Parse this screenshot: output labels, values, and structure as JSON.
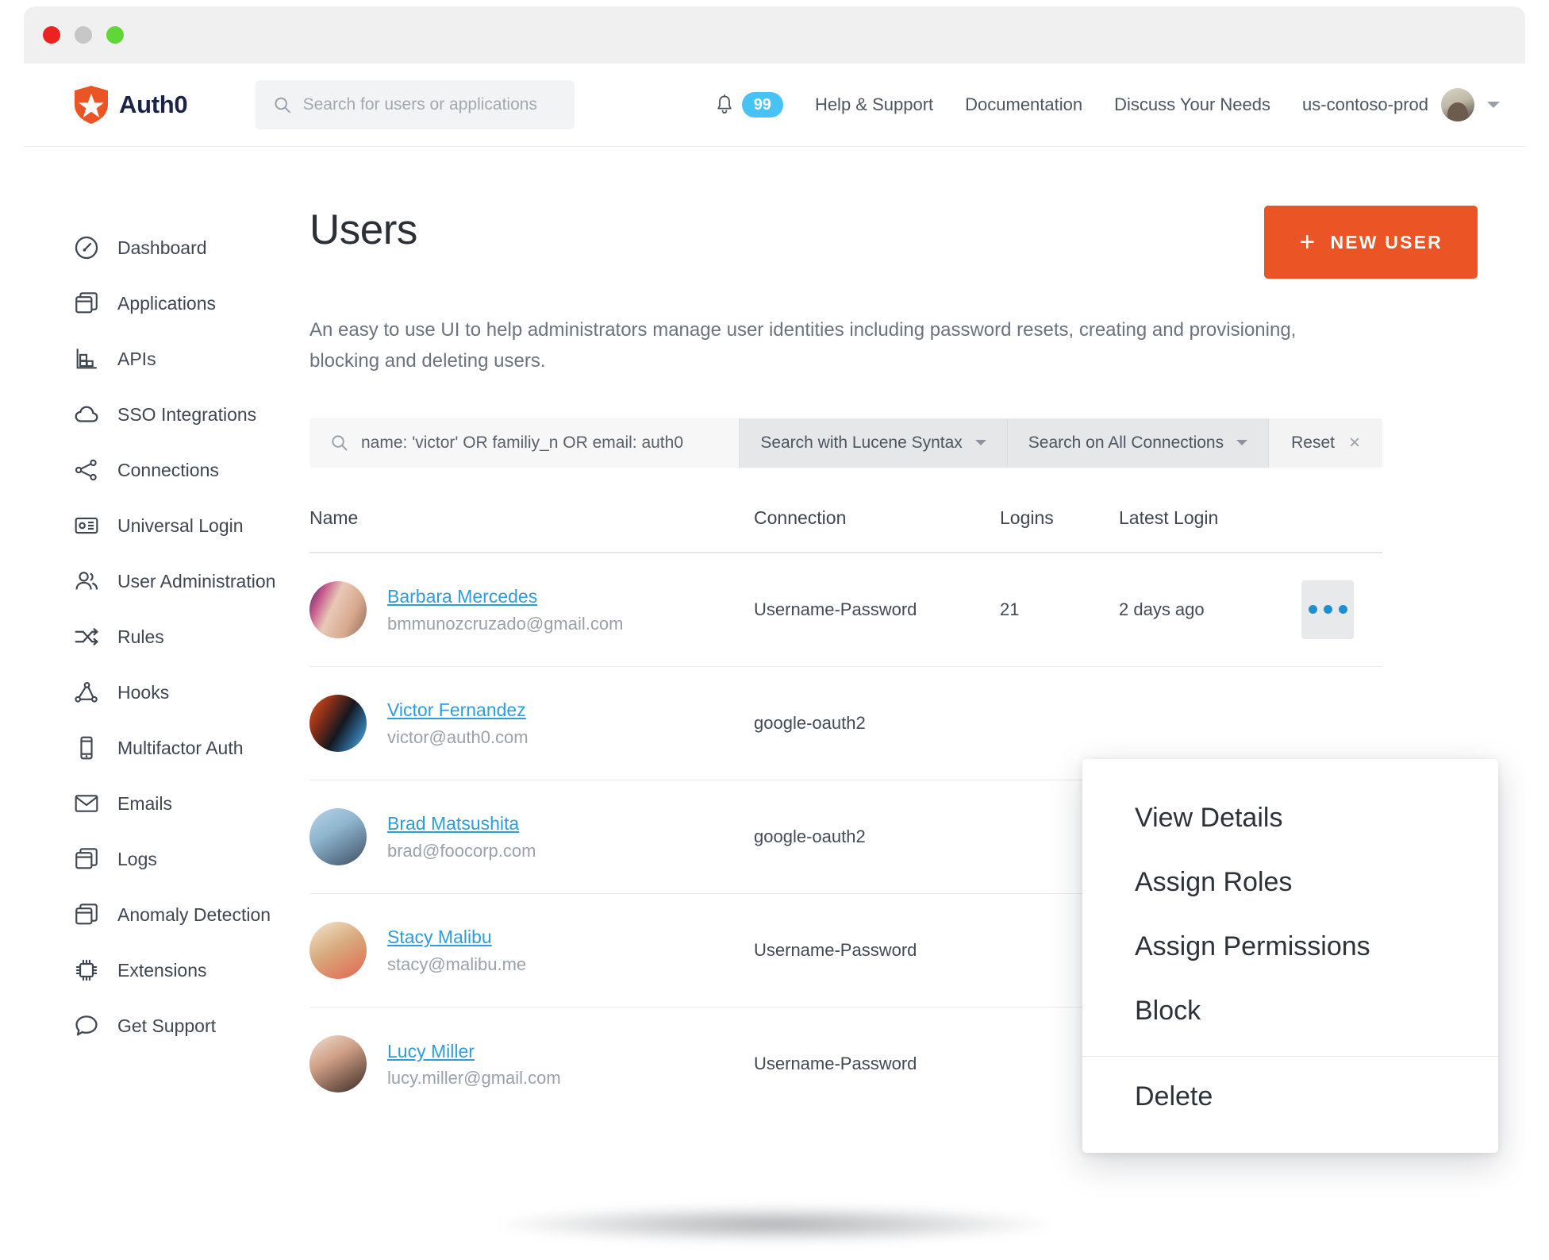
{
  "window_chrome": {
    "buttons": [
      "close",
      "minimize",
      "maximize"
    ]
  },
  "header": {
    "brand": "Auth0",
    "search_placeholder": "Search for users or applications",
    "search_value": "",
    "notifications_count": "99",
    "links": [
      {
        "label": "Help & Support"
      },
      {
        "label": "Documentation"
      },
      {
        "label": "Discuss Your Needs"
      }
    ],
    "tenant": "us-contoso-prod"
  },
  "sidebar": {
    "items": [
      {
        "label": "Dashboard",
        "icon": "gauge-icon"
      },
      {
        "label": "Applications",
        "icon": "windows-stack-icon"
      },
      {
        "label": "APIs",
        "icon": "bar-blocks-icon"
      },
      {
        "label": "SSO Integrations",
        "icon": "cloud-icon"
      },
      {
        "label": "Connections",
        "icon": "share-nodes-icon"
      },
      {
        "label": "Universal Login",
        "icon": "login-card-icon"
      },
      {
        "label": "User Administration",
        "icon": "users-icon"
      },
      {
        "label": "Rules",
        "icon": "arrows-shuffle-icon"
      },
      {
        "label": "Hooks",
        "icon": "hooks-graph-icon"
      },
      {
        "label": "Multifactor Auth",
        "icon": "mobile-device-icon"
      },
      {
        "label": "Emails",
        "icon": "envelope-icon"
      },
      {
        "label": "Logs",
        "icon": "windows-stack-icon"
      },
      {
        "label": "Anomaly Detection",
        "icon": "windows-stack-icon"
      },
      {
        "label": "Extensions",
        "icon": "chip-icon"
      },
      {
        "label": "Get Support",
        "icon": "speech-bubble-icon"
      }
    ]
  },
  "main": {
    "title": "Users",
    "new_user_button": "NEW USER",
    "description": "An easy to use UI to help administrators manage user identities including password resets, creating and provisioning, blocking and deleting users.",
    "filters": {
      "query_value": "name: 'victor' OR familiy_n OR email: auth0",
      "query_placeholder": "Search",
      "syntax_label": "Search with Lucene Syntax",
      "connections_label": "Search on All Connections",
      "reset_label": "Reset"
    },
    "table": {
      "columns": [
        "Name",
        "Connection",
        "Logins",
        "Latest Login"
      ],
      "rows": [
        {
          "name": "Barbara Mercedes",
          "email": "bmmunozcruzado@gmail.com",
          "connection": "Username-Password",
          "logins": "21",
          "latest_login": "2 days ago"
        },
        {
          "name": "Victor Fernandez",
          "email": "victor@auth0.com",
          "connection": "google-oauth2",
          "logins": "",
          "latest_login": ""
        },
        {
          "name": "Brad Matsushita",
          "email": "brad@foocorp.com",
          "connection": "google-oauth2",
          "logins": "",
          "latest_login": ""
        },
        {
          "name": "Stacy Malibu",
          "email": "stacy@malibu.me",
          "connection": "Username-Password",
          "logins": "",
          "latest_login": ""
        },
        {
          "name": "Lucy Miller",
          "email": "lucy.miller@gmail.com",
          "connection": "Username-Password",
          "logins": "",
          "latest_login": ""
        }
      ]
    },
    "context_menu": {
      "items": [
        "View Details",
        "Assign Roles",
        "Assign Permissions",
        "Block"
      ],
      "destructive_item": "Delete"
    }
  },
  "colors": {
    "brand_orange": "#eb5424",
    "link_blue": "#2f9cdb",
    "badge_blue": "#47c2f5"
  }
}
